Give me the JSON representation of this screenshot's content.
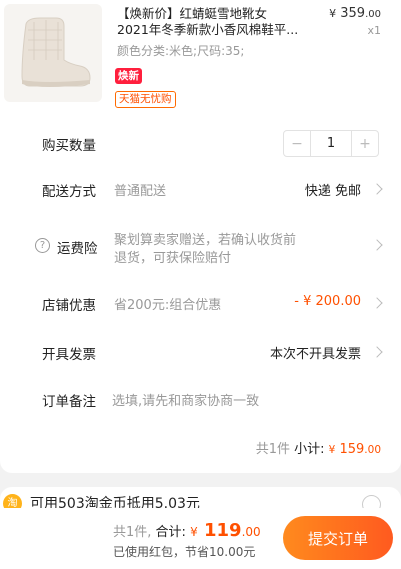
{
  "product": {
    "title_line1": "【焕新价】红蜻蜓雪地靴女",
    "title_line2": "2021年冬季新款小香风棉鞋平...",
    "price_currency": "¥",
    "price_int": "359",
    "price_dec": ".00",
    "quantity_label": "x1",
    "sku": "颜色分类:米色;尺码:35;",
    "tag_promo": "焕新",
    "tag_service": "天猫无忧购"
  },
  "quantity": {
    "label": "购买数量",
    "value": "1",
    "minus": "−",
    "plus": "+"
  },
  "delivery": {
    "label": "配送方式",
    "method": "普通配送",
    "value": "快递 免邮"
  },
  "insurance": {
    "help_icon": "?",
    "label": "运费险",
    "line1": "聚划算卖家赠送，若确认收货前",
    "line2": "退货，可获保险赔付"
  },
  "discount": {
    "label": "店铺优惠",
    "detail": "省200元:组合优惠",
    "value": "- ¥ 200.00"
  },
  "invoice": {
    "label": "开具发票",
    "value": "本次不开具发票"
  },
  "remark": {
    "label": "订单备注",
    "placeholder": "选填,请先和商家协商一致"
  },
  "subtotal": {
    "count": "共1件",
    "label": "小计:",
    "currency": "¥",
    "int": "159",
    "dec": ".00"
  },
  "coin": {
    "icon": "淘",
    "text": "可用503淘金币抵用5.03元"
  },
  "summary": {
    "count": "共1件,",
    "label": "合计:",
    "currency": "¥",
    "int": "119",
    "dec": ".00",
    "note": "已使用红包，节省10.00元"
  },
  "submit_label": "提交订单",
  "colors": {
    "accent": "#ff5000",
    "submit_start": "#ff8a1e",
    "submit_end": "#ff5a1f"
  }
}
